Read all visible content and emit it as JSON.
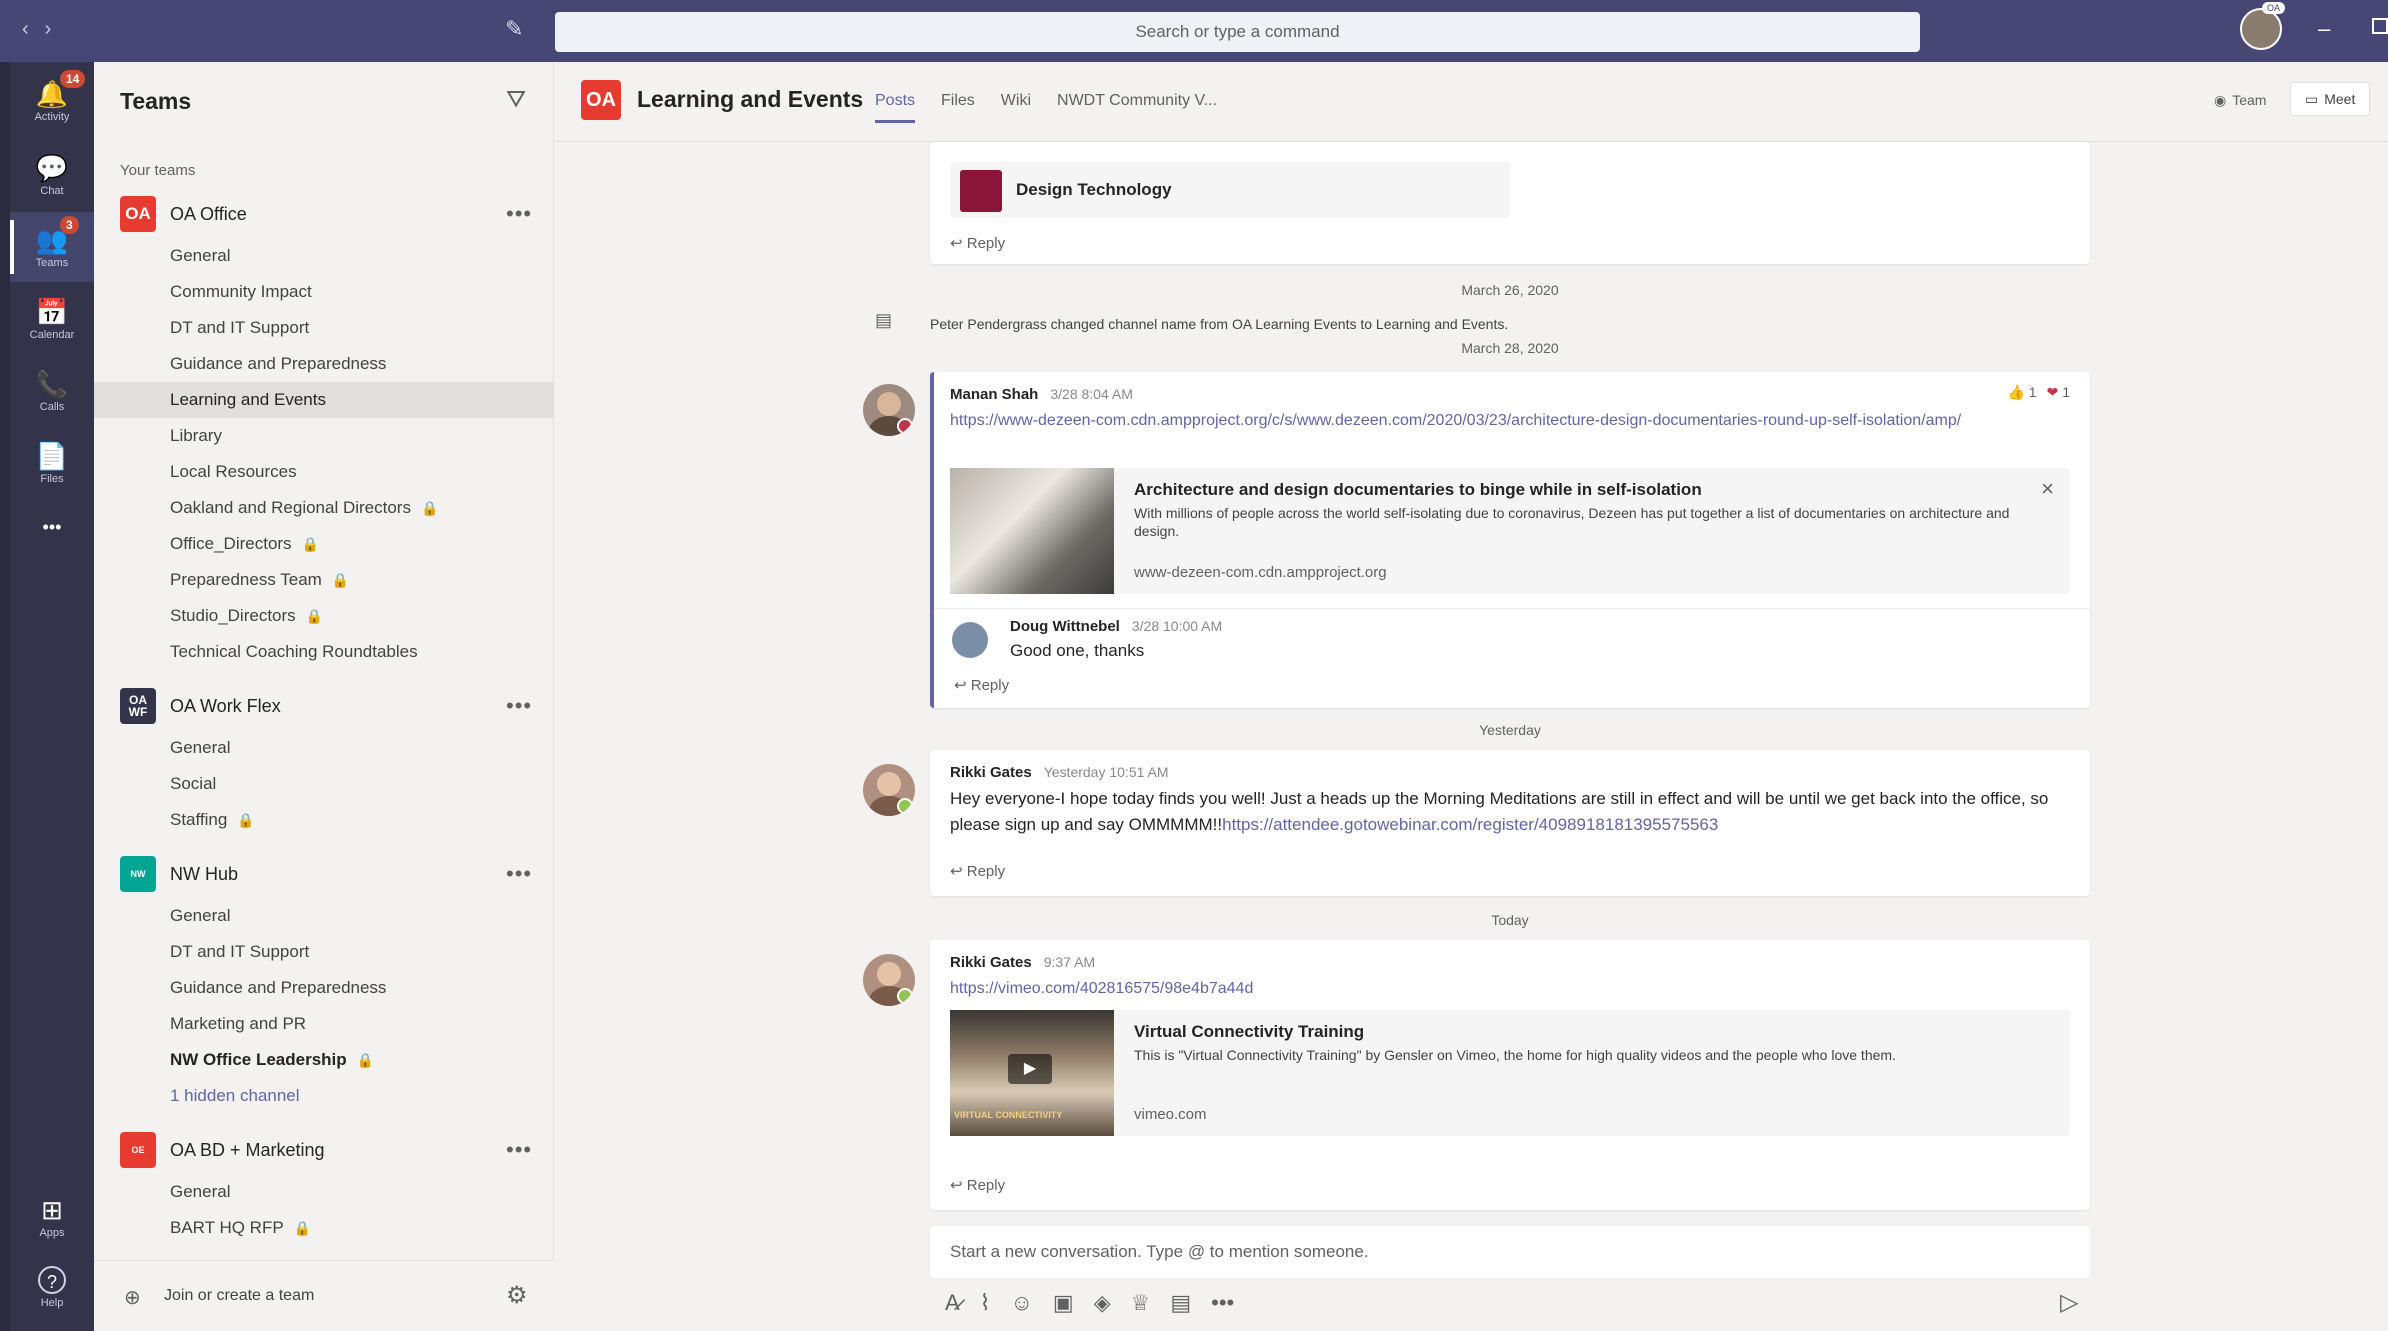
{
  "topbar": {
    "search_placeholder": "Search or type a command",
    "nav_back": "‹",
    "nav_fwd": "›",
    "compose_icon": "✎",
    "profile_badge": "OA"
  },
  "rail": [
    {
      "label": "Activity",
      "icon": "🔔",
      "badge": "14"
    },
    {
      "label": "Chat",
      "icon": "💬",
      "badge": ""
    },
    {
      "label": "Teams",
      "icon": "👥",
      "badge": "3"
    },
    {
      "label": "Calendar",
      "icon": "📅",
      "badge": ""
    },
    {
      "label": "Calls",
      "icon": "📞",
      "badge": ""
    },
    {
      "label": "Files",
      "icon": "📄",
      "badge": ""
    },
    {
      "label": "",
      "icon": "•••",
      "badge": ""
    },
    {
      "label": "Apps",
      "icon": "⊞",
      "badge": ""
    },
    {
      "label": "Help",
      "icon": "?",
      "badge": ""
    }
  ],
  "teams_pane": {
    "title": "Teams",
    "section": "Your teams",
    "teams": [
      {
        "avatar": "OA",
        "color": "#e73b32",
        "name": "OA Office",
        "channels": [
          {
            "name": "General"
          },
          {
            "name": "Community Impact"
          },
          {
            "name": "DT and IT Support"
          },
          {
            "name": "Guidance and Preparedness"
          },
          {
            "name": "Learning and Events",
            "selected": true
          },
          {
            "name": "Library"
          },
          {
            "name": "Local Resources"
          },
          {
            "name": "Oakland and Regional Directors",
            "private": true
          },
          {
            "name": "Office_Directors",
            "private": true
          },
          {
            "name": "Preparedness Team",
            "private": true
          },
          {
            "name": "Studio_Directors",
            "private": true
          },
          {
            "name": "Technical Coaching Roundtables"
          }
        ]
      },
      {
        "avatar": "OA WF",
        "color": "#33344a",
        "name": "OA Work Flex",
        "channels": [
          {
            "name": "General"
          },
          {
            "name": "Social"
          },
          {
            "name": "Staffing",
            "private": true
          }
        ]
      },
      {
        "avatar": "NW",
        "color": "#00a693",
        "name": "NW Hub",
        "channels": [
          {
            "name": "General"
          },
          {
            "name": "DT and IT Support"
          },
          {
            "name": "Guidance and Preparedness"
          },
          {
            "name": "Marketing and PR"
          },
          {
            "name": "NW Office Leadership",
            "private": true,
            "bold": true
          },
          {
            "name": "1 hidden channel",
            "link": true
          }
        ]
      },
      {
        "avatar": "OE",
        "color": "#e73b32",
        "name": "OA BD + Marketing",
        "channels": [
          {
            "name": "General"
          },
          {
            "name": "BART HQ RFP",
            "private": true
          }
        ]
      }
    ],
    "footer": "Join or create a team"
  },
  "channel": {
    "avatar": "OA",
    "title": "Learning and Events",
    "tabs": [
      "Posts",
      "Files",
      "Wiki",
      "NWDT Community V..."
    ],
    "team_btn": "Team",
    "meet_btn": "Meet"
  },
  "feed": {
    "top_card": {
      "tab_name": "Design Technology",
      "reply": "Reply"
    },
    "date1": "March 26, 2020",
    "system_msg": "Peter Pendergrass changed channel name from OA Learning Events to Learning and Events.",
    "date2": "March 28, 2020",
    "post1": {
      "author": "Manan Shah",
      "time": "3/28 8:04 AM",
      "link": "https://www-dezeen-com.cdn.ampproject.org/c/s/www.dezeen.com/2020/03/23/architecture-design-documentaries-round-up-self-isolation/amp/",
      "reactions": [
        {
          "icon": "👍",
          "count": "1"
        },
        {
          "icon": "❤",
          "count": "1"
        }
      ],
      "preview_title": "Architecture and design documentaries to binge while in self-isolation",
      "preview_desc": "With millions of people across the world self-isolating due to coronavirus, Dezeen has put together a list of documentaries on architecture and design.",
      "preview_url": "www-dezeen-com.cdn.ampproject.org",
      "reply_author": "Doug Wittnebel",
      "reply_time": "3/28 10:00 AM",
      "reply_text": "Good one, thanks",
      "reply": "Reply"
    },
    "date3": "Yesterday",
    "post2": {
      "author": "Rikki Gates",
      "time": "Yesterday 10:51 AM",
      "text": "Hey everyone-I hope today finds you well! Just a heads up the Morning Meditations are still in effect and will be until we get back into the office, so please sign up and say OMMMMM!!",
      "link": "https://attendee.gotowebinar.com/register/4098918181395575563",
      "reply": "Reply"
    },
    "date4": "Today",
    "post3": {
      "author": "Rikki Gates",
      "time": "9:37 AM",
      "link": "https://vimeo.com/402816575/98e4b7a44d",
      "preview_title": "Virtual Connectivity Training",
      "preview_desc": "This is \"Virtual Connectivity Training\" by Gensler on Vimeo, the home for high quality videos and the people who love them.",
      "preview_url": "vimeo.com",
      "thumb_caption": "VIRTUAL CONNECTIVITY",
      "reply": "Reply"
    },
    "compose_placeholder": "Start a new conversation. Type @ to mention someone."
  }
}
